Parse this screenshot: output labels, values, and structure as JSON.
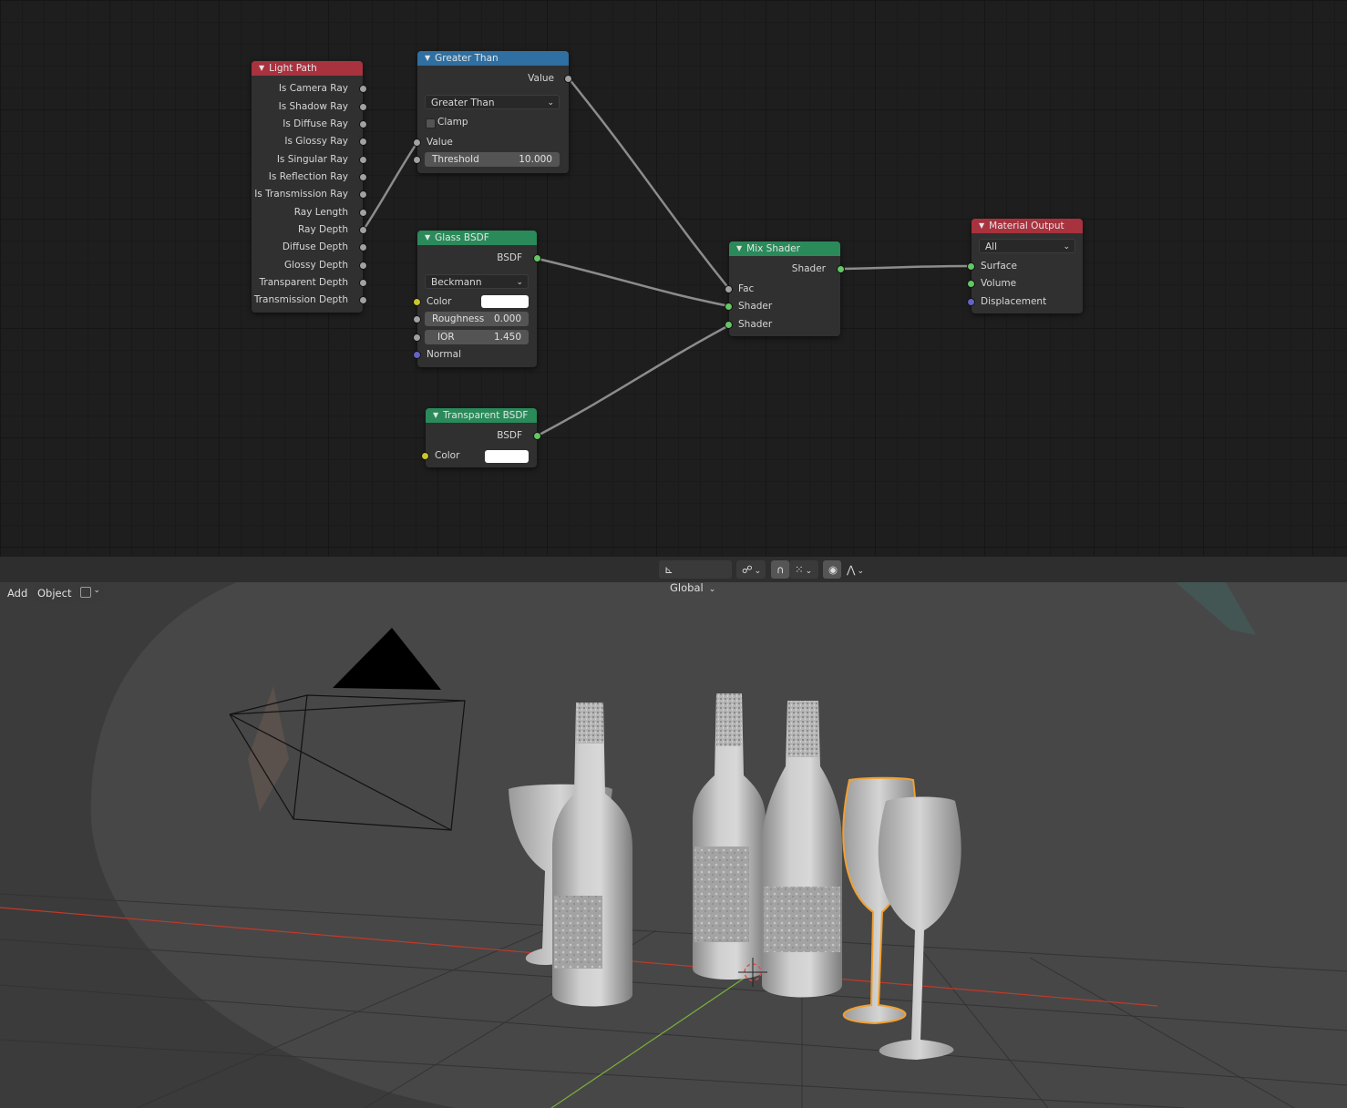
{
  "node_editor": {
    "nodes": {
      "light_path": {
        "title": "Light Path",
        "outputs": [
          "Is Camera Ray",
          "Is Shadow Ray",
          "Is Diffuse Ray",
          "Is Glossy Ray",
          "Is Singular Ray",
          "Is Reflection Ray",
          "Is Transmission Ray",
          "Ray Length",
          "Ray Depth",
          "Diffuse Depth",
          "Glossy Depth",
          "Transparent Depth",
          "Transmission Depth"
        ]
      },
      "greater_than": {
        "title": "Greater Than",
        "output": "Value",
        "operation": "Greater Than",
        "clamp_label": "Clamp",
        "input_value": "Value",
        "threshold_label": "Threshold",
        "threshold_value": "10.000"
      },
      "glass_bsdf": {
        "title": "Glass BSDF",
        "output": "BSDF",
        "distribution": "Beckmann",
        "color_label": "Color",
        "color_value": "#ffffff",
        "roughness_label": "Roughness",
        "roughness_value": "0.000",
        "ior_label": "IOR",
        "ior_value": "1.450",
        "normal_label": "Normal"
      },
      "transparent_bsdf": {
        "title": "Transparent BSDF",
        "output": "BSDF",
        "color_label": "Color",
        "color_value": "#ffffff"
      },
      "mix_shader": {
        "title": "Mix Shader",
        "output": "Shader",
        "inputs": [
          "Fac",
          "Shader",
          "Shader"
        ]
      },
      "material_output": {
        "title": "Material Output",
        "target": "All",
        "inputs": [
          "Surface",
          "Volume",
          "Displacement"
        ]
      }
    },
    "colors": {
      "header_red": "#a8323e",
      "header_blue": "#2f6fa1",
      "header_green": "#2a8a5a",
      "socket_gray": "#a1a1a1",
      "socket_green": "#63c763",
      "socket_yellow": "#c7c729",
      "socket_purple": "#6363c7"
    }
  },
  "viewport": {
    "header": {
      "transform_orientation": "Global",
      "icons": [
        "transform-axis-icon",
        "pivot-link-icon",
        "snap-magnet-icon",
        "snap-grid-icon",
        "proportional-edit-icon",
        "falloff-curve-icon"
      ]
    },
    "menu": {
      "add": "Add",
      "object": "Object"
    },
    "colors": {
      "selection_outline": "#f0a030",
      "x_axis": "#c0392b",
      "y_axis": "#7ab03a"
    }
  }
}
